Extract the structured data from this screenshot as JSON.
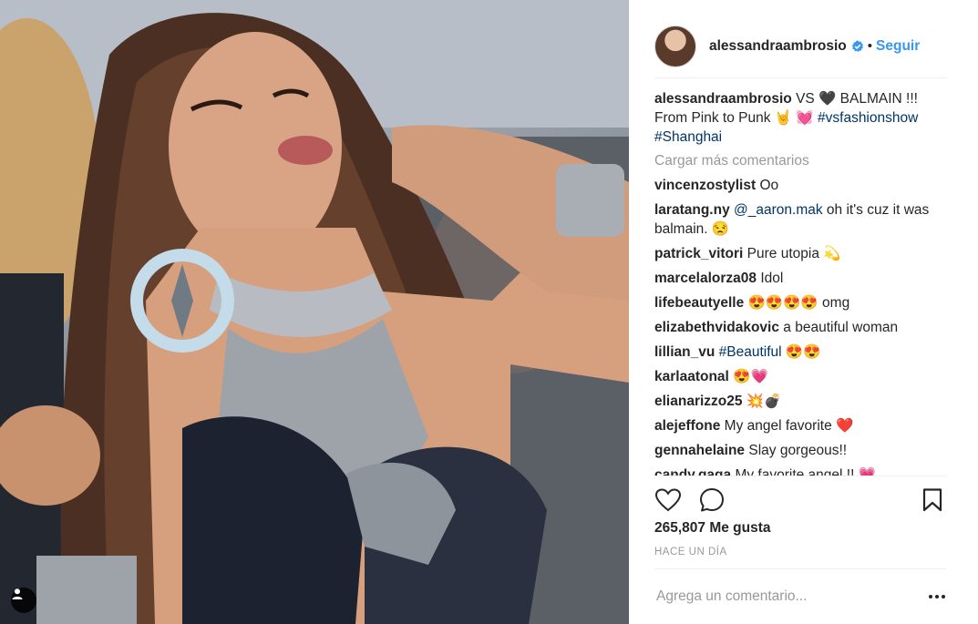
{
  "header": {
    "username": "alessandraambrosio",
    "separator": "•",
    "follow_label": "Seguir"
  },
  "caption": {
    "user": "alessandraambrosio",
    "text_1": " VS 🖤 BALMAIN !!! From Pink to Punk 🤘 💓 ",
    "hashtag_1": "#vsfashionshow",
    "hashtag_2": "#Shanghai"
  },
  "load_more_label": "Cargar más comentarios",
  "comments": [
    {
      "user": "vincenzostylist",
      "text": "Oo"
    },
    {
      "user": "laratang.ny",
      "mention": "@_aaron.mak",
      "text": " oh it's cuz it was balmain. 😒"
    },
    {
      "user": "patrick_vitori",
      "text": "Pure utopia 💫"
    },
    {
      "user": "marcelalorza08",
      "text": "Idol"
    },
    {
      "user": "lifebeautyelle",
      "text": "😍😍😍😍 omg"
    },
    {
      "user": "elizabethvidakovic",
      "text": "a beautiful woman"
    },
    {
      "user": "lillian_vu",
      "mention": "#Beautiful",
      "text": " 😍😍"
    },
    {
      "user": "karlaatonal",
      "text": "😍💗"
    },
    {
      "user": "elianarizzo25",
      "text": "💥💣"
    },
    {
      "user": "alejeffone",
      "text": "My angel favorite ❤️"
    },
    {
      "user": "gennahelaine",
      "text": "Slay gorgeous!!"
    },
    {
      "user": "candy.gaga",
      "text": "My favorite angel !! 💗"
    }
  ],
  "likes_label": "265,807 Me gusta",
  "time_label": "HACE UN DÍA",
  "add_comment_placeholder": "Agrega un comentario...",
  "colors": {
    "link": "#003569",
    "follow": "#3897f0",
    "muted": "#999999",
    "verified": "#3897f0"
  },
  "icons": [
    "heart-icon",
    "comment-icon",
    "bookmark-icon",
    "more-options-icon",
    "verified-badge-icon",
    "user-tag-icon"
  ]
}
